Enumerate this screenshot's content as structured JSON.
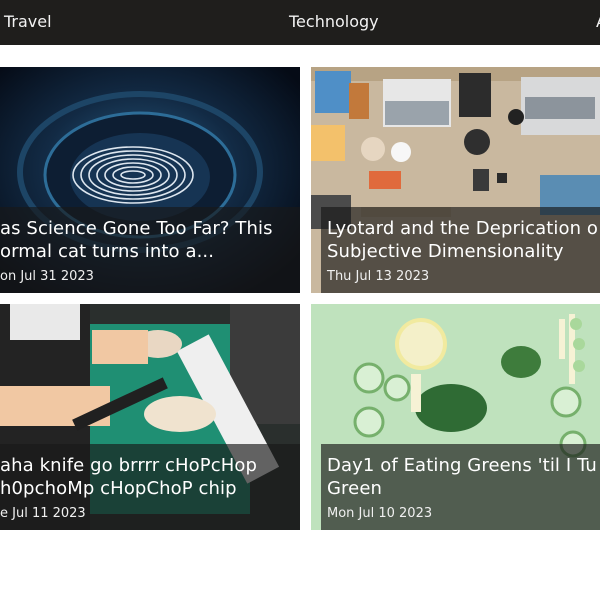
{
  "nav": {
    "items": [
      {
        "label": "Travel"
      },
      {
        "label": "Technology"
      },
      {
        "label": "A"
      }
    ]
  },
  "cards": [
    {
      "title": "as Science Gone Too Far? This\normal cat turns into a...",
      "date": "on Jul 31 2023"
    },
    {
      "title": "Lyotard and the Deprication o\nSubjective Dimensionality",
      "date": "Thu Jul 13 2023"
    },
    {
      "title": "aha knife go brrrr cHoPcHop\nh0pchoMp cHopChoP chip",
      "date": "e Jul 11 2023"
    },
    {
      "title": "Day1 of Eating Greens 'til I Tu\nGreen",
      "date": "Mon Jul 10 2023"
    }
  ]
}
